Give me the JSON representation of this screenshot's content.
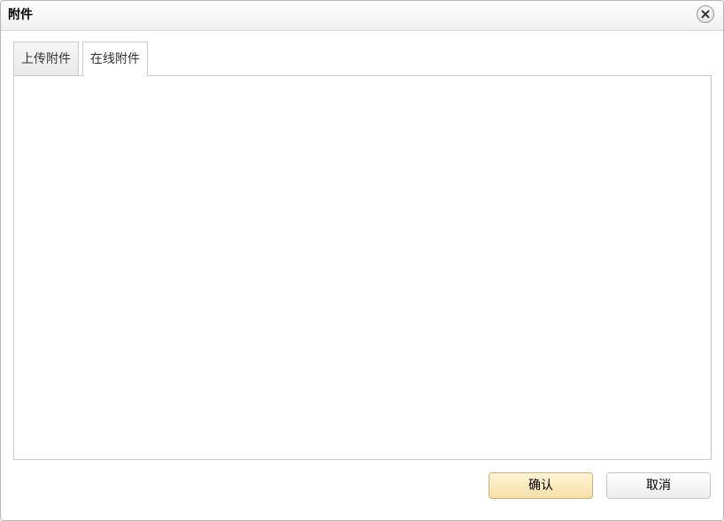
{
  "dialog": {
    "title": "附件",
    "close_icon": "close-icon"
  },
  "tabs": [
    {
      "label": "上传附件",
      "active": false
    },
    {
      "label": "在线附件",
      "active": true
    }
  ],
  "buttons": {
    "confirm_label": "确认",
    "cancel_label": "取消"
  },
  "colors": {
    "confirm_bg": "#f7dfa8",
    "border": "#c9c9c9"
  }
}
